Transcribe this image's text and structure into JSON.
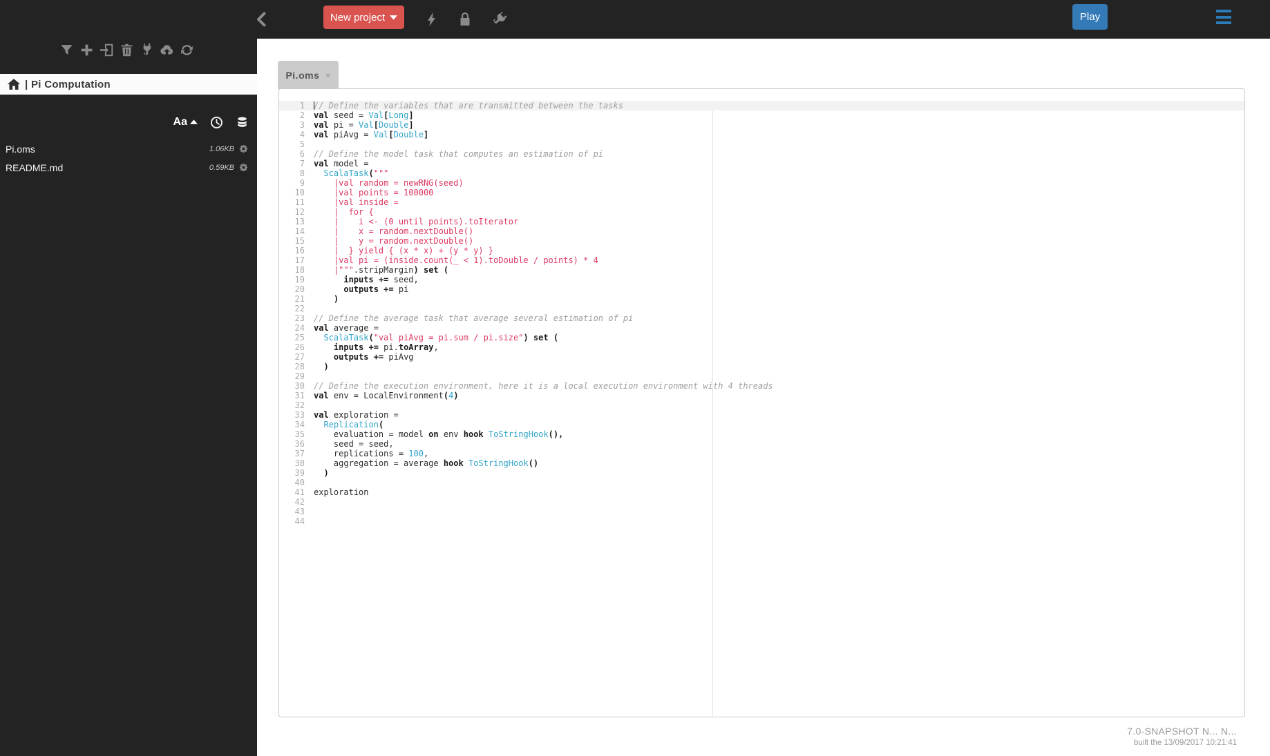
{
  "topbar": {
    "back_icon": "chevron-left",
    "new_project_label": "New project",
    "icons": [
      "lightning",
      "lock",
      "plug"
    ],
    "play_label": "Play",
    "menu_icon": "hamburger-menu",
    "colors": {
      "bar": "#232323",
      "new_project": "#d9534f",
      "play": "#337ab7",
      "menu": "#2b7cb8"
    }
  },
  "sidebar": {
    "toolbar_icons": [
      "filter",
      "plus",
      "paste",
      "trash",
      "plug",
      "cloud-upload",
      "refresh"
    ],
    "header": {
      "home_icon": "home",
      "title": "| Pi Computation"
    },
    "sort": {
      "alpha_label": "Aa",
      "alpha_dir_icon": "caret-up",
      "icons": [
        "clock",
        "database"
      ]
    },
    "files": [
      {
        "name": "Pi.oms",
        "size": "1.06KB",
        "gear_icon": "gear"
      },
      {
        "name": "README.md",
        "size": "0.59KB",
        "gear_icon": "gear"
      }
    ]
  },
  "editor": {
    "tab": {
      "label": "Pi.oms",
      "close": "×"
    },
    "lines": [
      {
        "n": 1,
        "active": true,
        "seg": [
          [
            "c",
            "// Define the variables that are transmitted between the tasks"
          ]
        ]
      },
      {
        "n": 2,
        "seg": [
          [
            "k",
            "val"
          ],
          [
            "p",
            " seed = "
          ],
          [
            "t",
            "Val"
          ],
          [
            "k",
            "["
          ],
          [
            "t",
            "Long"
          ],
          [
            "k",
            "]"
          ]
        ]
      },
      {
        "n": 3,
        "seg": [
          [
            "k",
            "val"
          ],
          [
            "p",
            " pi = "
          ],
          [
            "t",
            "Val"
          ],
          [
            "k",
            "["
          ],
          [
            "t",
            "Double"
          ],
          [
            "k",
            "]"
          ]
        ]
      },
      {
        "n": 4,
        "seg": [
          [
            "k",
            "val"
          ],
          [
            "p",
            " piAvg = "
          ],
          [
            "t",
            "Val"
          ],
          [
            "k",
            "["
          ],
          [
            "t",
            "Double"
          ],
          [
            "k",
            "]"
          ]
        ]
      },
      {
        "n": 5,
        "seg": []
      },
      {
        "n": 6,
        "seg": [
          [
            "c",
            "// Define the model task that computes an estimation of pi"
          ]
        ]
      },
      {
        "n": 7,
        "seg": [
          [
            "k",
            "val"
          ],
          [
            "p",
            " model ="
          ]
        ]
      },
      {
        "n": 8,
        "seg": [
          [
            "p",
            "  "
          ],
          [
            "t",
            "ScalaTask"
          ],
          [
            "k",
            "("
          ],
          [
            "s",
            "\"\"\""
          ]
        ]
      },
      {
        "n": 9,
        "seg": [
          [
            "s",
            "    |val random = newRNG(seed)"
          ]
        ]
      },
      {
        "n": 10,
        "seg": [
          [
            "s",
            "    |val points = 100000"
          ]
        ]
      },
      {
        "n": 11,
        "seg": [
          [
            "s",
            "    |val inside ="
          ]
        ]
      },
      {
        "n": 12,
        "seg": [
          [
            "s",
            "    |  for {"
          ]
        ]
      },
      {
        "n": 13,
        "seg": [
          [
            "s",
            "    |    i <- (0 until points).toIterator"
          ]
        ]
      },
      {
        "n": 14,
        "seg": [
          [
            "s",
            "    |    x = random.nextDouble()"
          ]
        ]
      },
      {
        "n": 15,
        "seg": [
          [
            "s",
            "    |    y = random.nextDouble()"
          ]
        ]
      },
      {
        "n": 16,
        "seg": [
          [
            "s",
            "    |  } yield { (x * x) + (y * y) }"
          ]
        ]
      },
      {
        "n": 17,
        "seg": [
          [
            "s",
            "    |val pi = (inside.count(_ < 1).toDouble / points) * 4"
          ]
        ]
      },
      {
        "n": 18,
        "seg": [
          [
            "s",
            "    |\"\"\""
          ],
          [
            "p",
            ".stripMargin"
          ],
          [
            "k",
            ")"
          ],
          [
            "p",
            " "
          ],
          [
            "k",
            "set"
          ],
          [
            "p",
            " "
          ],
          [
            "k",
            "("
          ]
        ]
      },
      {
        "n": 19,
        "seg": [
          [
            "p",
            "      "
          ],
          [
            "k",
            "inputs"
          ],
          [
            "p",
            " "
          ],
          [
            "k",
            "+="
          ],
          [
            "p",
            " seed,"
          ]
        ]
      },
      {
        "n": 20,
        "seg": [
          [
            "p",
            "      "
          ],
          [
            "k",
            "outputs"
          ],
          [
            "p",
            " "
          ],
          [
            "k",
            "+="
          ],
          [
            "p",
            " pi"
          ]
        ]
      },
      {
        "n": 21,
        "seg": [
          [
            "p",
            "    "
          ],
          [
            "k",
            ")"
          ]
        ]
      },
      {
        "n": 22,
        "seg": []
      },
      {
        "n": 23,
        "seg": [
          [
            "c",
            "// Define the average task that average several estimation of pi"
          ]
        ]
      },
      {
        "n": 24,
        "seg": [
          [
            "k",
            "val"
          ],
          [
            "p",
            " average ="
          ]
        ]
      },
      {
        "n": 25,
        "seg": [
          [
            "p",
            "  "
          ],
          [
            "t",
            "ScalaTask"
          ],
          [
            "k",
            "("
          ],
          [
            "s",
            "\"val piAvg = pi.sum / pi.size\""
          ],
          [
            "k",
            ")"
          ],
          [
            "p",
            " "
          ],
          [
            "k",
            "set"
          ],
          [
            "p",
            " "
          ],
          [
            "k",
            "("
          ]
        ]
      },
      {
        "n": 26,
        "seg": [
          [
            "p",
            "    "
          ],
          [
            "k",
            "inputs"
          ],
          [
            "p",
            " "
          ],
          [
            "k",
            "+="
          ],
          [
            "p",
            " pi."
          ],
          [
            "k",
            "toArray"
          ],
          [
            "p",
            ","
          ]
        ]
      },
      {
        "n": 27,
        "seg": [
          [
            "p",
            "    "
          ],
          [
            "k",
            "outputs"
          ],
          [
            "p",
            " "
          ],
          [
            "k",
            "+="
          ],
          [
            "p",
            " piAvg"
          ]
        ]
      },
      {
        "n": 28,
        "seg": [
          [
            "p",
            "  "
          ],
          [
            "k",
            ")"
          ]
        ]
      },
      {
        "n": 29,
        "seg": []
      },
      {
        "n": 30,
        "seg": [
          [
            "c",
            "// Define the execution environment, here it is a local execution environment with 4 threads"
          ]
        ]
      },
      {
        "n": 31,
        "seg": [
          [
            "k",
            "val"
          ],
          [
            "p",
            " env = LocalEnvironment"
          ],
          [
            "k",
            "("
          ],
          [
            "t",
            "4"
          ],
          [
            "k",
            ")"
          ]
        ]
      },
      {
        "n": 32,
        "seg": []
      },
      {
        "n": 33,
        "seg": [
          [
            "k",
            "val"
          ],
          [
            "p",
            " exploration ="
          ]
        ]
      },
      {
        "n": 34,
        "seg": [
          [
            "p",
            "  "
          ],
          [
            "t",
            "Replication"
          ],
          [
            "k",
            "("
          ]
        ]
      },
      {
        "n": 35,
        "seg": [
          [
            "p",
            "    evaluation = model "
          ],
          [
            "k",
            "on"
          ],
          [
            "p",
            " env "
          ],
          [
            "k",
            "hook"
          ],
          [
            "p",
            " "
          ],
          [
            "t",
            "ToStringHook"
          ],
          [
            "k",
            "(),"
          ]
        ]
      },
      {
        "n": 36,
        "seg": [
          [
            "p",
            "    seed = seed,"
          ]
        ]
      },
      {
        "n": 37,
        "seg": [
          [
            "p",
            "    replications = "
          ],
          [
            "t",
            "100"
          ],
          [
            "p",
            ","
          ]
        ]
      },
      {
        "n": 38,
        "seg": [
          [
            "p",
            "    aggregation = average "
          ],
          [
            "k",
            "hook"
          ],
          [
            "p",
            " "
          ],
          [
            "t",
            "ToStringHook"
          ],
          [
            "k",
            "()"
          ]
        ]
      },
      {
        "n": 39,
        "seg": [
          [
            "p",
            "  "
          ],
          [
            "k",
            ")"
          ]
        ]
      },
      {
        "n": 40,
        "seg": []
      },
      {
        "n": 41,
        "seg": [
          [
            "p",
            "exploration"
          ]
        ]
      },
      {
        "n": 42,
        "seg": []
      },
      {
        "n": 43,
        "seg": []
      },
      {
        "n": 44,
        "seg": []
      }
    ]
  },
  "footer": {
    "version": "7.0-SNAPSHOT N... N...",
    "built": "built the 13/09/2017 10:21:41"
  }
}
